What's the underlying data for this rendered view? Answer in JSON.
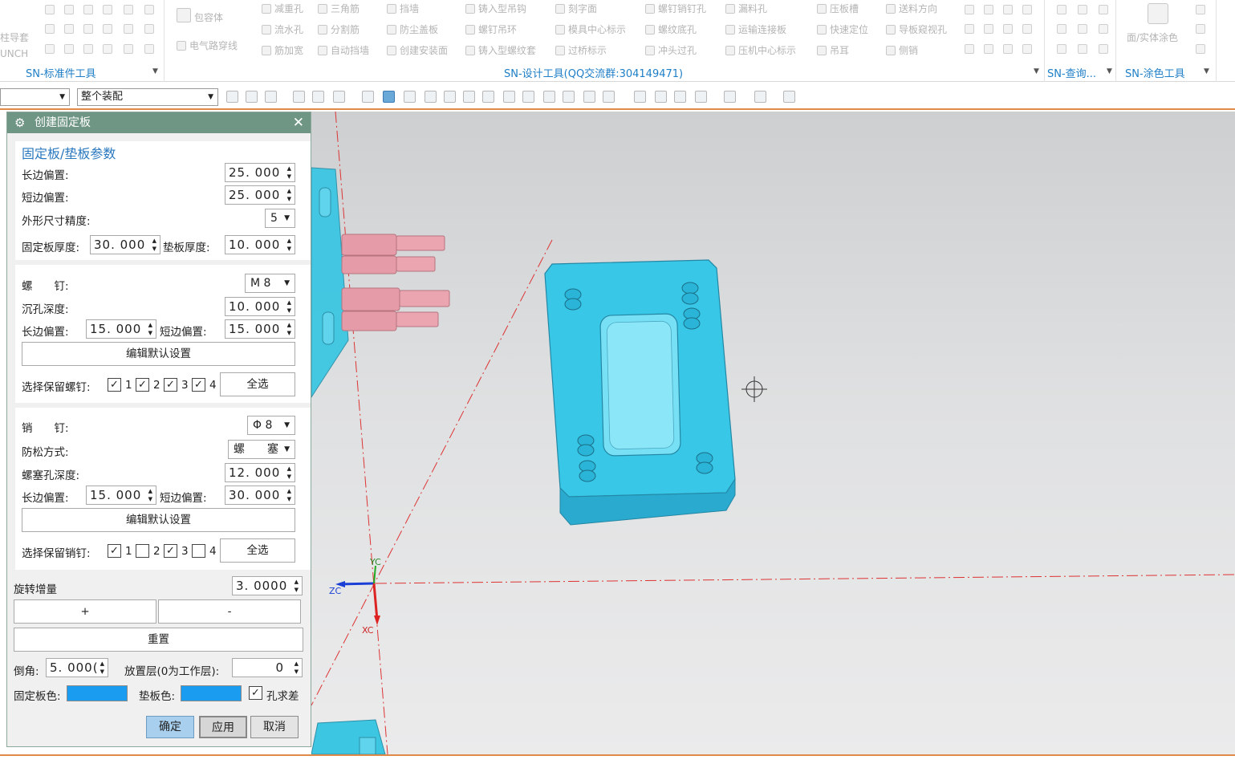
{
  "ribbon": {
    "std_group": {
      "label": "SN-标准件工具",
      "row_left": [
        "柱导套",
        "UNCH"
      ]
    },
    "design_group": {
      "label": "SN-设计工具(QQ交流群:304149471)",
      "col1": [
        "包容体",
        "电气路穿线"
      ],
      "col2": [
        "减重孔",
        "流水孔",
        "筋加宽"
      ],
      "col3": [
        "三角筋",
        "分割筋",
        "自动挡墙"
      ],
      "col4": [
        "挡墙",
        "防尘盖板",
        "创建安装面"
      ],
      "col5": [
        "铸入型吊钩",
        "螺钉吊环",
        "铸入型螺纹套"
      ],
      "col6": [
        "刻字面",
        "模具中心标示",
        "过桥标示"
      ],
      "col7": [
        "螺钉销钉孔",
        "螺纹底孔",
        "冲头过孔"
      ],
      "col8": [
        "漏料孔",
        "运输连接板",
        "压机中心标示"
      ],
      "col9": [
        "压板槽",
        "快速定位",
        "吊耳"
      ],
      "col10": [
        "送料方向",
        "导板窥视孔",
        "侧销"
      ]
    },
    "query_group": {
      "label": "SN-查询..."
    },
    "paint_group": {
      "label": "SN-涂色工具",
      "item": "面/实体涂色"
    }
  },
  "toolbar": {
    "select1": "",
    "select2": "整个装配"
  },
  "viewport": {
    "axes": {
      "yc": "YC",
      "zc": "ZC",
      "xc": "XC"
    }
  },
  "dialog": {
    "title": "创建固定板",
    "plate": {
      "header": "固定板/垫板参数",
      "long_offset_label": "长边偏置:",
      "long_offset": "25. 000",
      "short_offset_label": "短边偏置:",
      "short_offset": "25. 000",
      "precision_label": "外形尺寸精度:",
      "precision": "5",
      "thickness_label": "固定板厚度:",
      "thickness": "30. 000",
      "backing_label": "垫板厚度:",
      "backing": "10. 000"
    },
    "screw": {
      "label": "螺　　钉:",
      "size": "M 8",
      "counterbore_label": "沉孔深度:",
      "counterbore": "10. 000",
      "long_offset_label": "长边偏置:",
      "long_offset": "15. 000",
      "short_offset_label": "短边偏置:",
      "short_offset": "15. 000",
      "edit_label": "编辑默认设置",
      "keep_label": "选择保留螺钉:",
      "checks": [
        {
          "num": "1",
          "checked": true
        },
        {
          "num": "2",
          "checked": true
        },
        {
          "num": "3",
          "checked": true
        },
        {
          "num": "4",
          "checked": true
        }
      ],
      "select_all": "全选"
    },
    "pin": {
      "label": "销　　钉:",
      "size": "Φ 8",
      "lock_label": "防松方式:",
      "lock": "螺　　塞",
      "plug_depth_label": "螺塞孔深度:",
      "plug_depth": "12. 000",
      "long_offset_label": "长边偏置:",
      "long_offset": "15. 000",
      "short_offset_label": "短边偏置:",
      "short_offset": "30. 000",
      "edit_label": "编辑默认设置",
      "keep_label": "选择保留销钉:",
      "checks": [
        {
          "num": "1",
          "checked": true
        },
        {
          "num": "2",
          "checked": false
        },
        {
          "num": "3",
          "checked": true
        },
        {
          "num": "4",
          "checked": false
        }
      ],
      "select_all": "全选"
    },
    "rotate_label": "旋转增量",
    "rotate": "3. 0000",
    "plus": "+",
    "minus": "-",
    "reset": "重置",
    "chamfer_label": "倒角:",
    "chamfer": "5. 000(",
    "layer_label": "放置层(0为工作层):",
    "layer": "0",
    "plate_color_label": "固定板色:",
    "backing_color_label": "垫板色:",
    "plate_color": "#1a9cf0",
    "backing_color": "#1a9cf0",
    "hole_diff_label": "孔求差",
    "hole_diff": true,
    "ok": "确定",
    "apply": "应用",
    "cancel": "取消"
  }
}
